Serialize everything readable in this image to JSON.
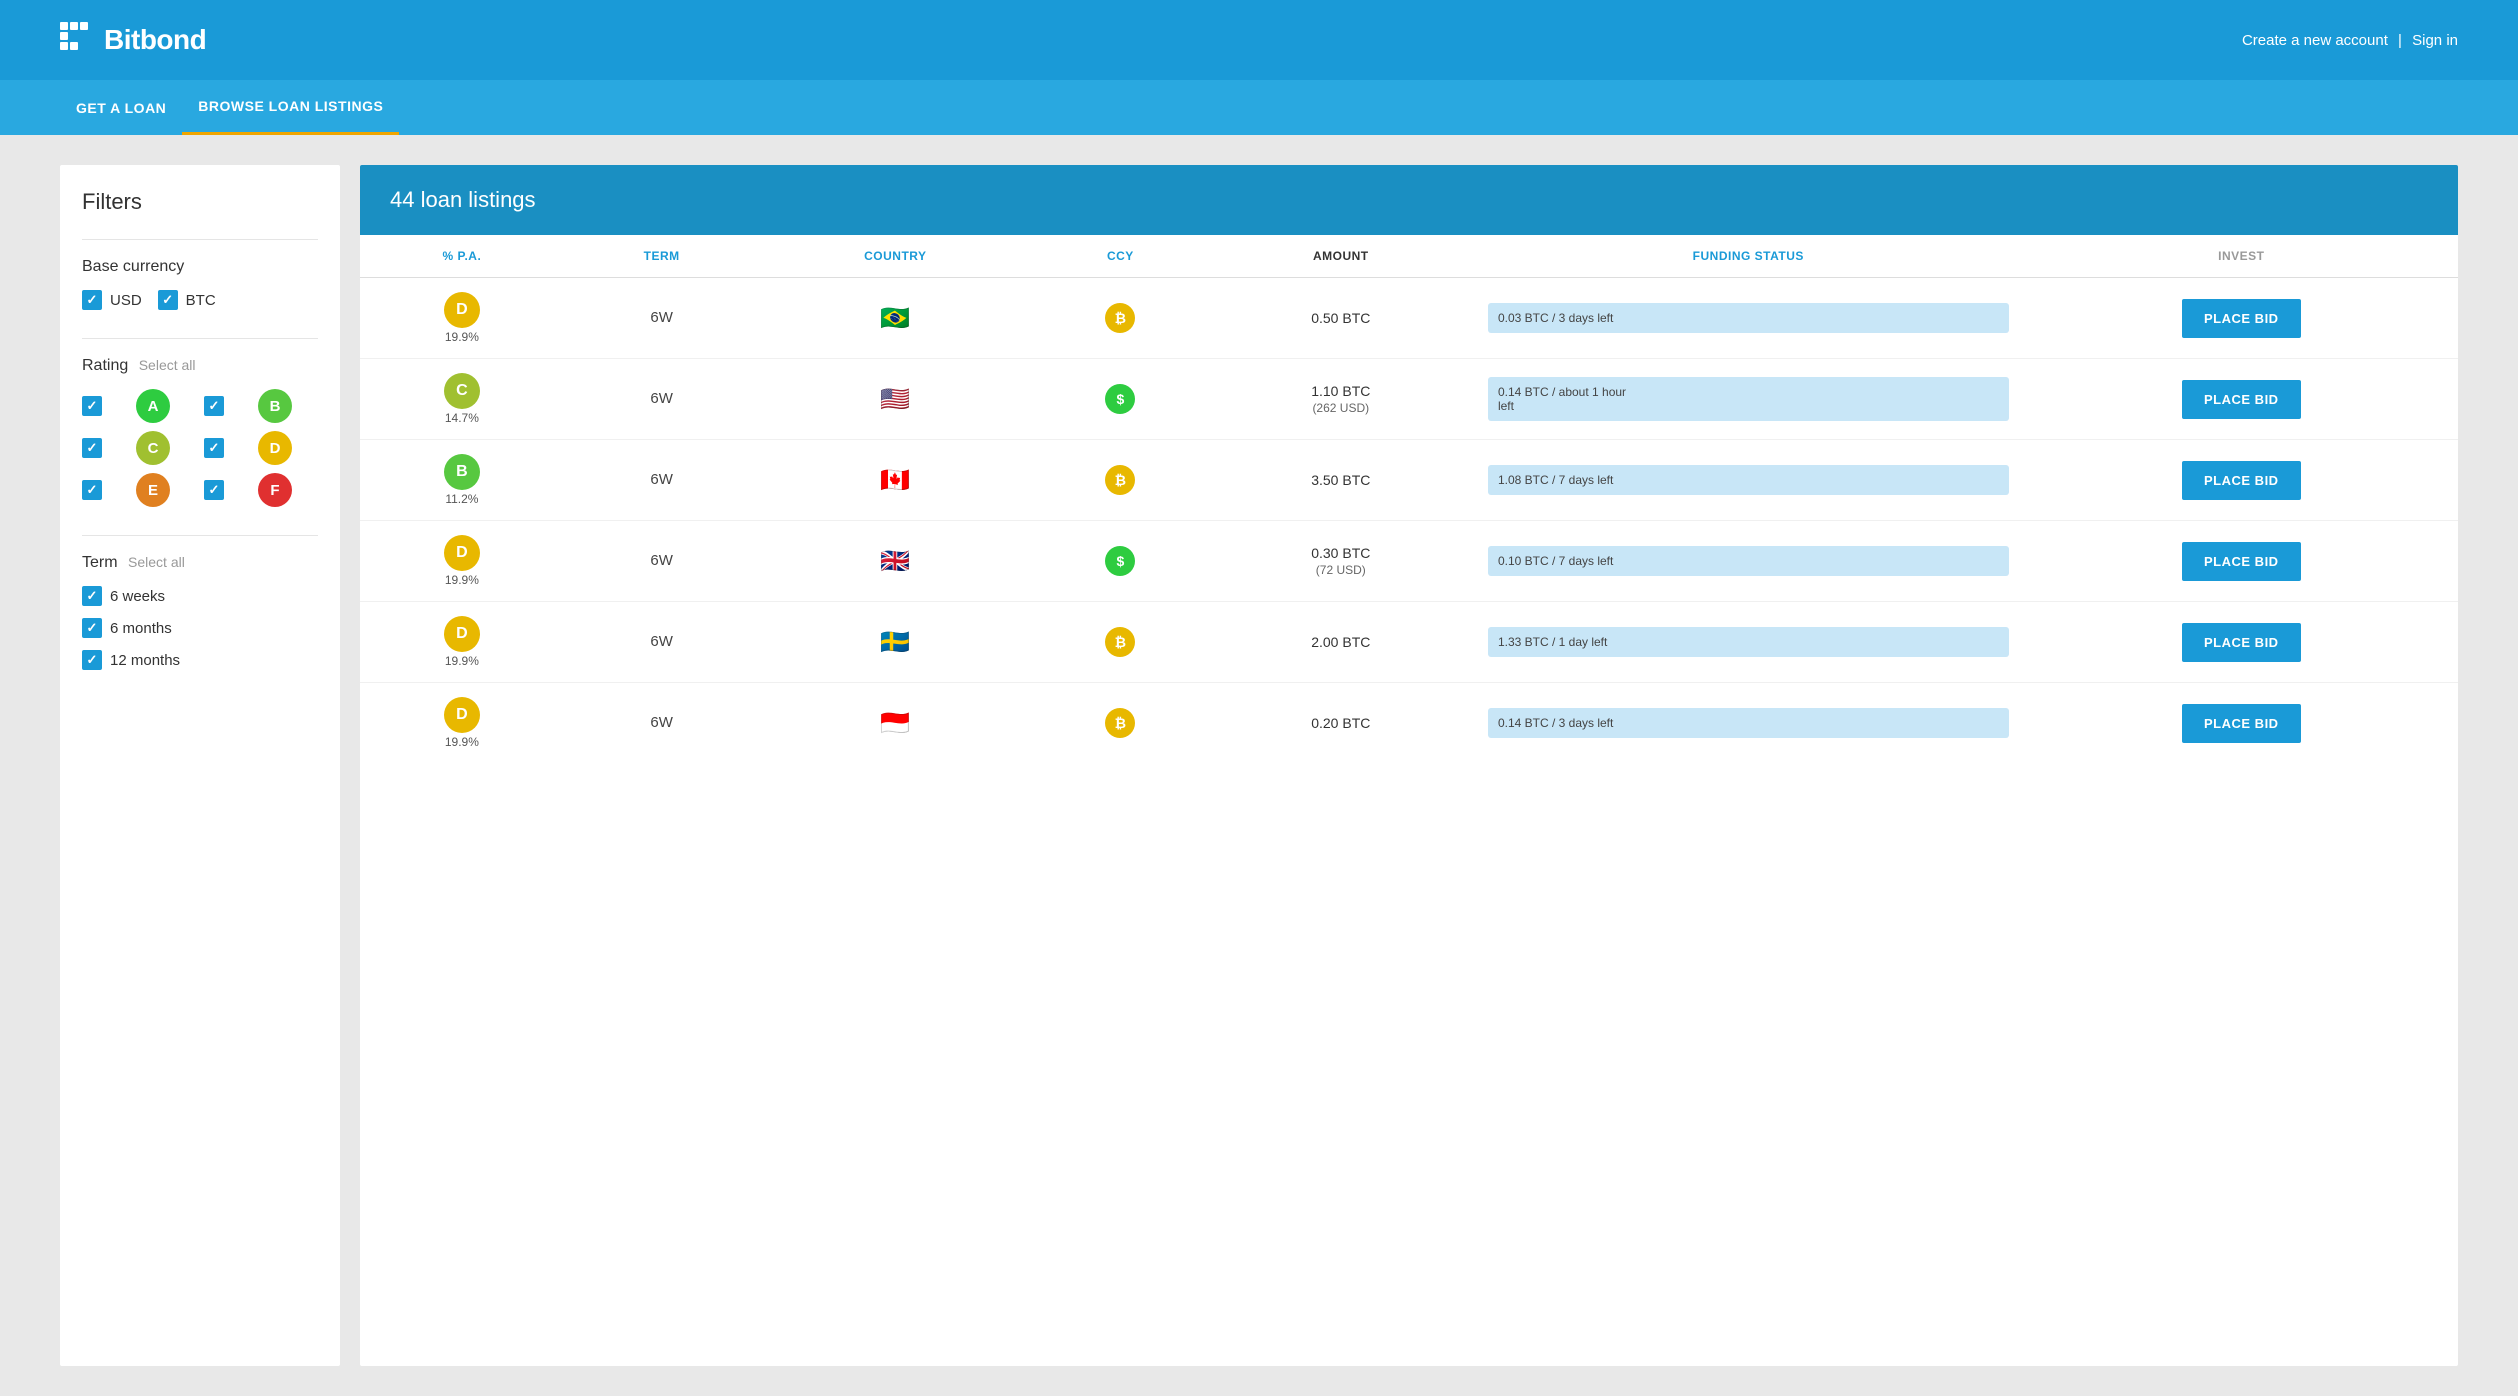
{
  "header": {
    "logo_text": "Bitbond",
    "logo_icon": "▪▪▪",
    "create_account": "Create a new account",
    "divider": "|",
    "sign_in": "Sign in"
  },
  "nav": {
    "items": [
      {
        "label": "GET A LOAN",
        "active": false
      },
      {
        "label": "BROWSE LOAN LISTINGS",
        "active": true
      }
    ]
  },
  "filters": {
    "title": "Filters",
    "base_currency": {
      "label": "Base currency",
      "options": [
        {
          "id": "usd",
          "label": "USD",
          "checked": true
        },
        {
          "id": "btc",
          "label": "BTC",
          "checked": true
        }
      ]
    },
    "rating": {
      "label": "Rating",
      "select_all_label": "Select all",
      "options": [
        {
          "id": "A",
          "label": "A",
          "color": "#2ecc40",
          "checked": true
        },
        {
          "id": "B",
          "label": "B",
          "color": "#57c840",
          "checked": true
        },
        {
          "id": "C",
          "label": "C",
          "color": "#a0c030",
          "checked": true
        },
        {
          "id": "D",
          "label": "D",
          "color": "#e8b800",
          "checked": true
        },
        {
          "id": "E",
          "label": "E",
          "color": "#e08020",
          "checked": true
        },
        {
          "id": "F",
          "label": "F",
          "color": "#e03030",
          "checked": true
        }
      ]
    },
    "term": {
      "label": "Term",
      "select_all_label": "Select all",
      "options": [
        {
          "id": "6w",
          "label": "6 weeks",
          "checked": true
        },
        {
          "id": "6m",
          "label": "6 months",
          "checked": true
        },
        {
          "id": "12m",
          "label": "12 months",
          "checked": true
        }
      ]
    }
  },
  "listings": {
    "title": "44 loan listings",
    "columns": {
      "ppa": "% P.A.",
      "term": "TERM",
      "country": "COUNTRY",
      "ccy": "CCY",
      "amount": "AMOUNT",
      "funding_status": "FUNDING STATUS",
      "invest": "INVEST"
    },
    "rows": [
      {
        "rating": "D",
        "rating_color": "#e8b800",
        "pct": "19.9%",
        "term": "6W",
        "flag": "🇧🇷",
        "ccy_symbol": "₿",
        "ccy_color": "#e8b800",
        "amount": "0.50 BTC",
        "amount2": "",
        "funding": "0.03 BTC / 3 days left",
        "bid_label": "PLACE BID"
      },
      {
        "rating": "C",
        "rating_color": "#a0c030",
        "pct": "14.7%",
        "term": "6W",
        "flag": "🇺🇸",
        "ccy_symbol": "$",
        "ccy_color": "#2ecc40",
        "amount": "1.10 BTC",
        "amount2": "(262 USD)",
        "funding": "0.14 BTC / about 1 hour left",
        "bid_label": "PLACE BID"
      },
      {
        "rating": "B",
        "rating_color": "#57c840",
        "pct": "11.2%",
        "term": "6W",
        "flag": "🇨🇦",
        "ccy_symbol": "₿",
        "ccy_color": "#e8b800",
        "amount": "3.50 BTC",
        "amount2": "",
        "funding": "1.08 BTC / 7 days left",
        "bid_label": "PLACE BID"
      },
      {
        "rating": "D",
        "rating_color": "#e8b800",
        "pct": "19.9%",
        "term": "6W",
        "flag": "🇬🇧",
        "ccy_symbol": "$",
        "ccy_color": "#2ecc40",
        "amount": "0.30 BTC",
        "amount2": "(72 USD)",
        "funding": "0.10 BTC / 7 days left",
        "bid_label": "PLACE BID"
      },
      {
        "rating": "D",
        "rating_color": "#e8b800",
        "pct": "19.9%",
        "term": "6W",
        "flag": "🇸🇪",
        "ccy_symbol": "₿",
        "ccy_color": "#e8b800",
        "amount": "2.00 BTC",
        "amount2": "",
        "funding": "1.33 BTC / 1 day left",
        "bid_label": "PLACE BID"
      },
      {
        "rating": "D",
        "rating_color": "#e8b800",
        "pct": "19.9%",
        "term": "6W",
        "flag": "🇮🇩",
        "ccy_symbol": "₿",
        "ccy_color": "#e8b800",
        "amount": "0.20 BTC",
        "amount2": "",
        "funding": "0.14 BTC / 3 days left",
        "bid_label": "PLACE BID"
      }
    ]
  }
}
